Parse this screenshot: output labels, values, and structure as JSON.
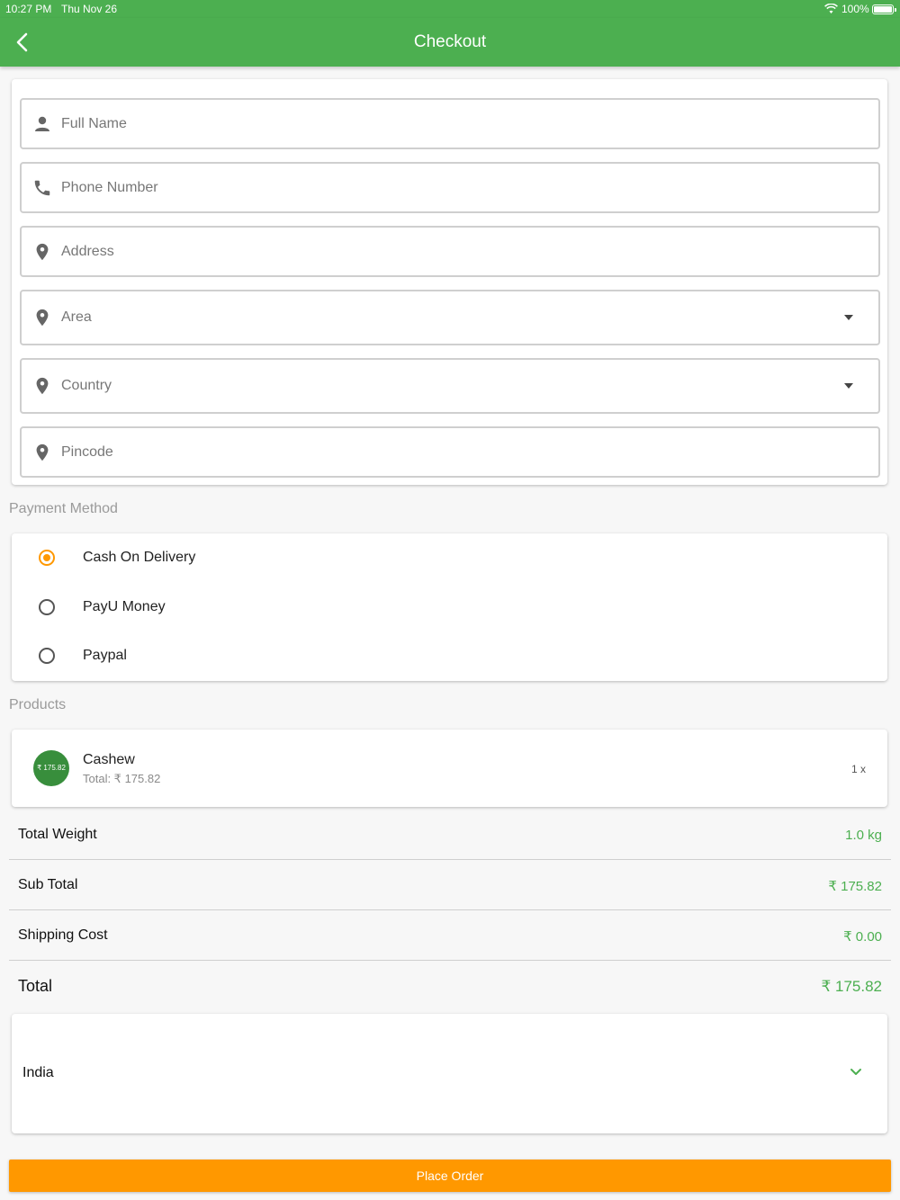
{
  "status_bar": {
    "time": "10:27 PM",
    "date": "Thu Nov 26",
    "battery": "100%"
  },
  "header": {
    "title": "Checkout"
  },
  "form": {
    "full_name_placeholder": "Full Name",
    "phone_placeholder": "Phone Number",
    "address_placeholder": "Address",
    "area_placeholder": "Area",
    "country_placeholder": "Country",
    "pincode_placeholder": "Pincode"
  },
  "payment": {
    "title": "Payment Method",
    "options": [
      {
        "label": "Cash On Delivery",
        "selected": true
      },
      {
        "label": "PayU Money",
        "selected": false
      },
      {
        "label": "Paypal",
        "selected": false
      }
    ]
  },
  "products": {
    "title": "Products",
    "items": [
      {
        "badge": "₹ 175.82",
        "name": "Cashew",
        "total": "Total: ₹ 175.82",
        "qty": "1 x"
      }
    ]
  },
  "summary": {
    "total_weight_label": "Total Weight",
    "total_weight_value": "1.0 kg",
    "sub_total_label": "Sub Total",
    "sub_total_value": "₹ 175.82",
    "shipping_label": "Shipping Cost",
    "shipping_value": "₹ 0.00",
    "total_label": "Total",
    "total_value": "₹ 175.82"
  },
  "country_select": {
    "value": "India"
  },
  "actions": {
    "place_order_label": "Place Order"
  },
  "colors": {
    "primary": "#4caf50",
    "accent": "#ff9800",
    "badge": "#388e3c"
  }
}
